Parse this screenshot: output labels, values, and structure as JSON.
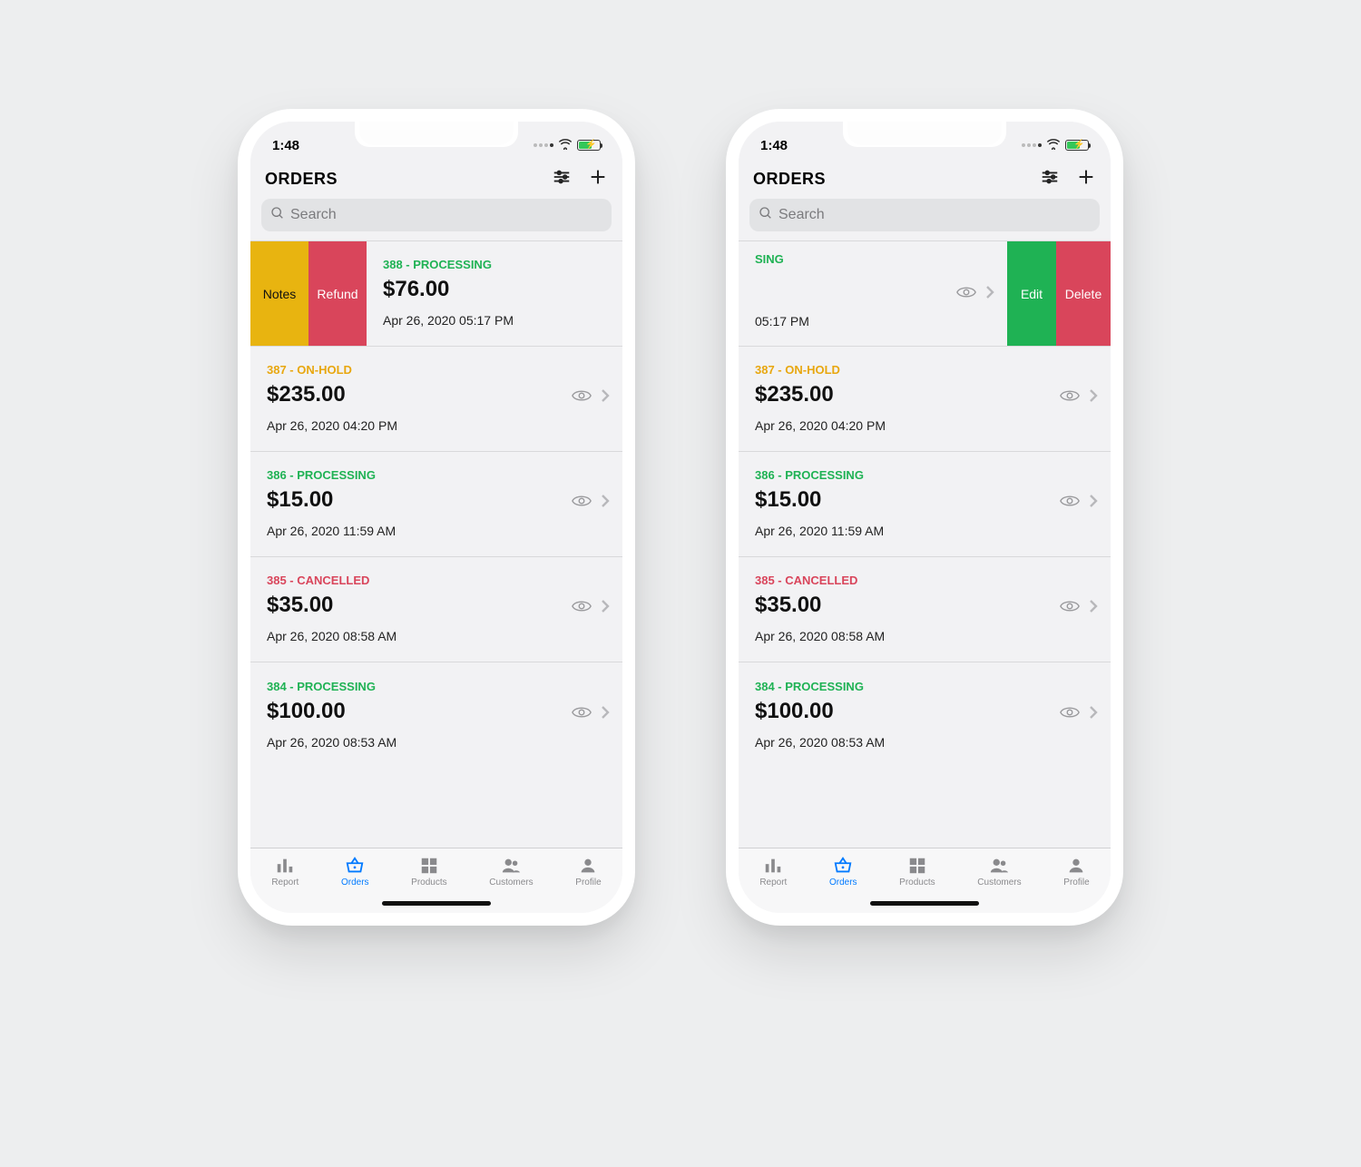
{
  "statusbar": {
    "time": "1:48"
  },
  "header": {
    "title": "ORDERS"
  },
  "search": {
    "placeholder": "Search"
  },
  "swipe": {
    "notes": "Notes",
    "refund": "Refund",
    "edit": "Edit",
    "delete": "Delete"
  },
  "phone2_row1": {
    "status_fragment": "SING",
    "time_fragment": "05:17 PM"
  },
  "orders": [
    {
      "status_line": "388 - PROCESSING",
      "status_class": "processing",
      "amount": "$76.00",
      "date": "Apr 26, 2020 05:17 PM"
    },
    {
      "status_line": "387 - ON-HOLD",
      "status_class": "onhold",
      "amount": "$235.00",
      "date": "Apr 26, 2020 04:20 PM"
    },
    {
      "status_line": "386 - PROCESSING",
      "status_class": "processing",
      "amount": "$15.00",
      "date": "Apr 26, 2020 11:59 AM"
    },
    {
      "status_line": "385 - CANCELLED",
      "status_class": "cancelled",
      "amount": "$35.00",
      "date": "Apr 26, 2020 08:58 AM"
    },
    {
      "status_line": "384 - PROCESSING",
      "status_class": "processing",
      "amount": "$100.00",
      "date": "Apr 26, 2020 08:53 AM"
    }
  ],
  "tabs": {
    "report": "Report",
    "orders": "Orders",
    "products": "Products",
    "customers": "Customers",
    "profile": "Profile"
  }
}
